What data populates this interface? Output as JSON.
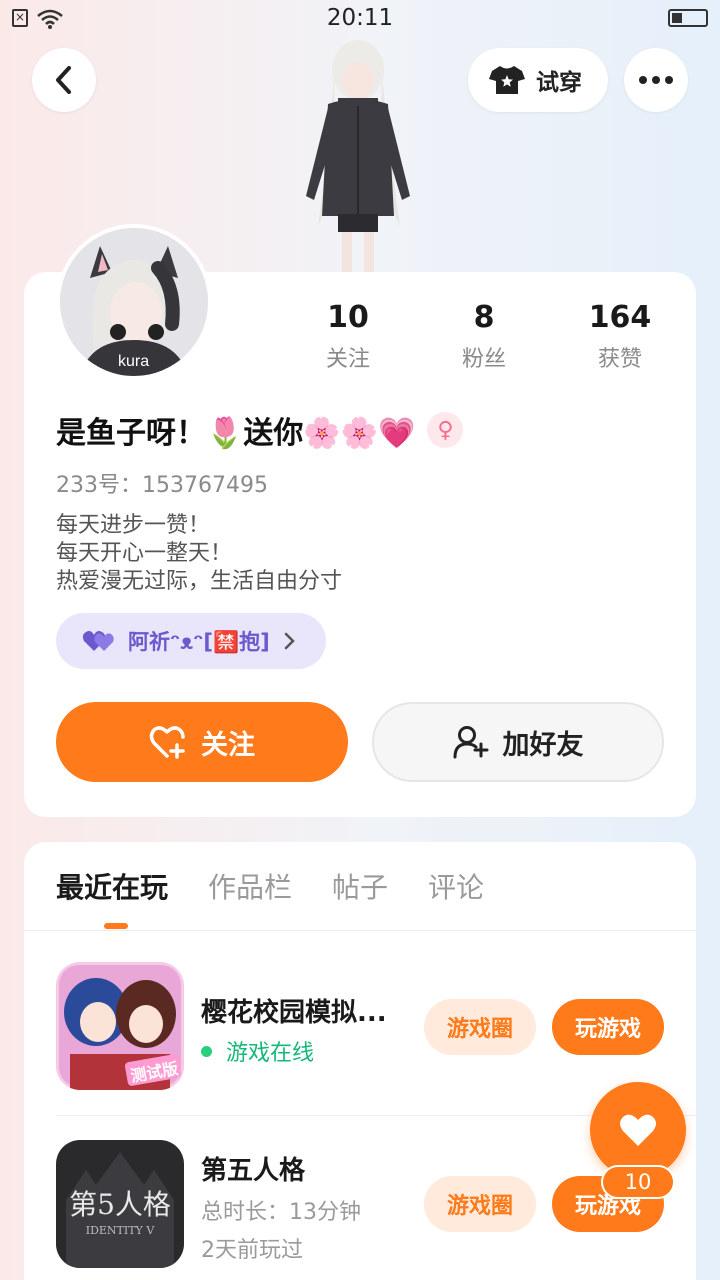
{
  "status_bar": {
    "time": "20:11"
  },
  "header": {
    "try_on_label": "试穿"
  },
  "stats": [
    {
      "num": "10",
      "label": "关注"
    },
    {
      "num": "8",
      "label": "粉丝"
    },
    {
      "num": "164",
      "label": "获赞"
    }
  ],
  "profile": {
    "name": "是鱼子呀！🌷送你🌸🌸💗",
    "gender_symbol": "♀",
    "uid": "233号：153767495",
    "bio_lines": [
      "每天进步一赞！",
      "每天开心一整天！",
      "热爱漫无过际，生活自由分寸"
    ],
    "cp_text": "阿祈ᵔᴥᵔ[🈲抱]",
    "avatar_text": "kura"
  },
  "actions": {
    "follow_label": "关注",
    "add_friend_label": "加好友"
  },
  "tabs": [
    "最近在玩",
    "作品栏",
    "帖子",
    "评论"
  ],
  "games": [
    {
      "title": "樱花校园模拟...",
      "status": "游戏在线",
      "badge": "测试版",
      "circle_label": "游戏圈",
      "play_label": "玩游戏"
    },
    {
      "title": "第五人格",
      "duration": "总时长：13分钟",
      "last_played": "2天前玩过",
      "logo_text": "第5人格",
      "logo_sub": "IDENTITY V",
      "circle_label": "游戏圈",
      "play_label": "玩游戏"
    }
  ],
  "fab": {
    "count": "10"
  },
  "colors": {
    "accent": "#ff7a1a",
    "online": "#16b877",
    "cp": "#6a5acd"
  }
}
